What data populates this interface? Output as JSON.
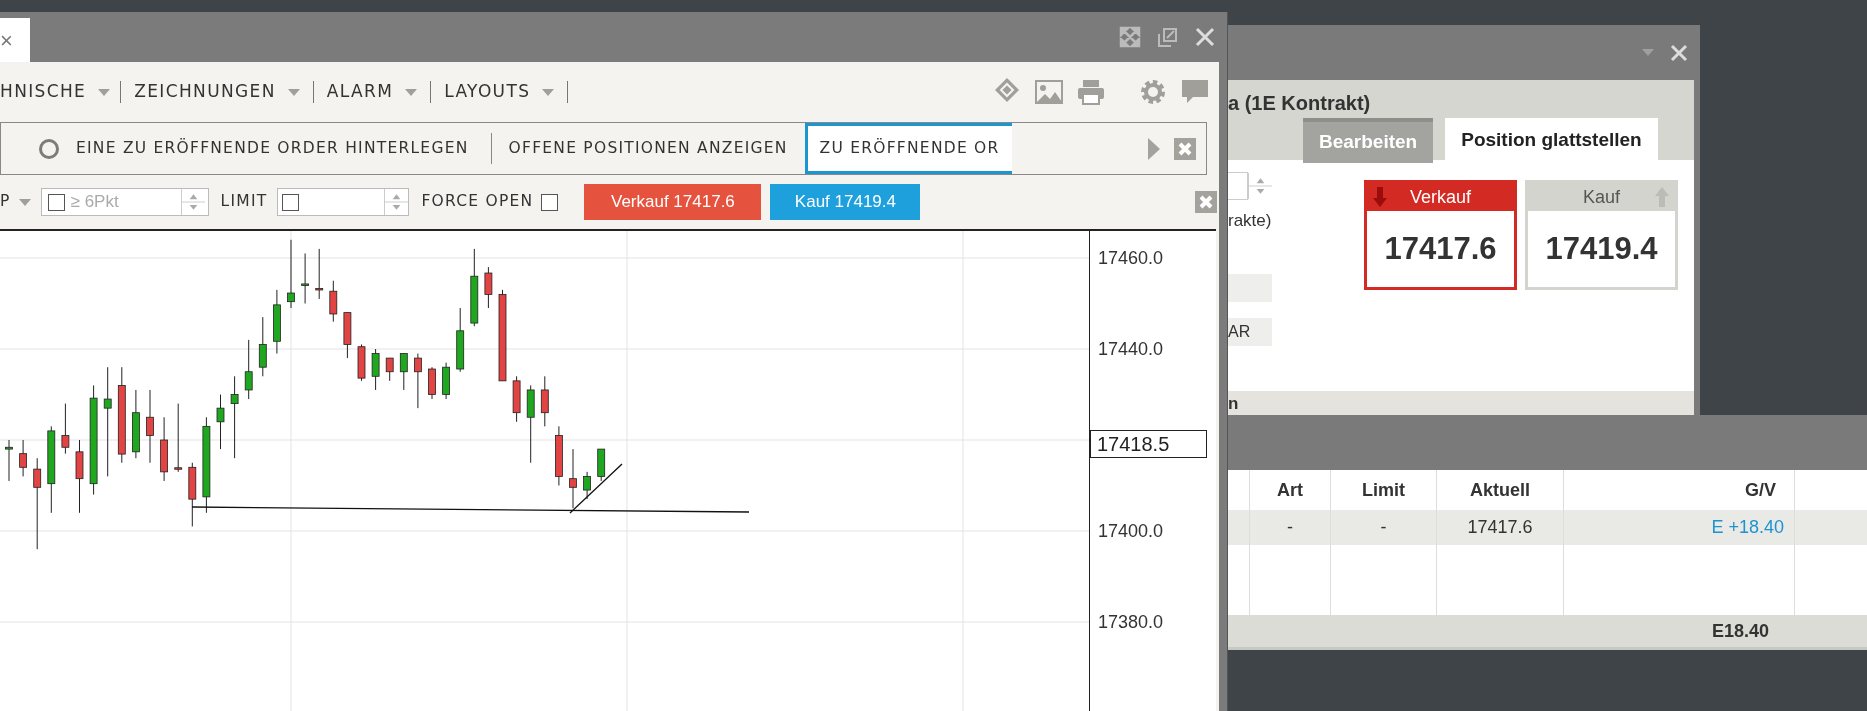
{
  "main_window": {
    "tab_close": "×",
    "menu": [
      {
        "label": "HNISCHE"
      },
      {
        "label": "ZEICHNUNGEN"
      },
      {
        "label": "ALARM"
      },
      {
        "label": "LAYOUTS"
      }
    ],
    "order_tabs": [
      {
        "label": "EINE ZU ERÖFFNENDE ORDER HINTERLEGEN",
        "kind": "radio",
        "selected": false
      },
      {
        "label": "OFFENE POSITIONEN ANZEIGEN",
        "kind": "tab",
        "selected": false
      },
      {
        "label": "ZU ERÖFFNENDE OR",
        "kind": "tab",
        "selected": true
      }
    ],
    "order_bar": {
      "stop_label": "P",
      "stop_field": {
        "placeholder": "≥ 6Pkt",
        "checked": false
      },
      "limit_label": "LIMIT",
      "limit_field": {
        "checked": false
      },
      "force_open": {
        "label": "FORCE OPEN",
        "checked": false
      },
      "sell_button": "Verkauf 17417.6",
      "buy_button": "Kauf 17419.4"
    },
    "chart": {
      "price_labels": [
        "17460.0",
        "17440.0",
        "17400.0",
        "17380.0"
      ],
      "current_price": "17418.5"
    }
  },
  "trade_window": {
    "title": "a (1E Kontrakt)",
    "tabs": [
      {
        "label": "Bearbeiten",
        "selected": false
      },
      {
        "label": "Position glattstellen",
        "selected": true
      }
    ],
    "quantity_hint": "rakte)",
    "rows": [
      {
        "text": "AR"
      }
    ],
    "quotes": [
      {
        "label": "Verkauf",
        "price": "17417.6",
        "kind": "sell",
        "selected": true
      },
      {
        "label": "Kauf",
        "price": "17419.4",
        "kind": "buy",
        "selected": false
      }
    ],
    "section": "n"
  },
  "positions_window": {
    "columns": [
      "Art",
      "Limit",
      "Aktuell",
      "G/V"
    ],
    "rows": [
      {
        "cells": [
          "-",
          "-",
          "17417.6",
          "E +18.40"
        ]
      }
    ],
    "total": "E18.40"
  }
}
